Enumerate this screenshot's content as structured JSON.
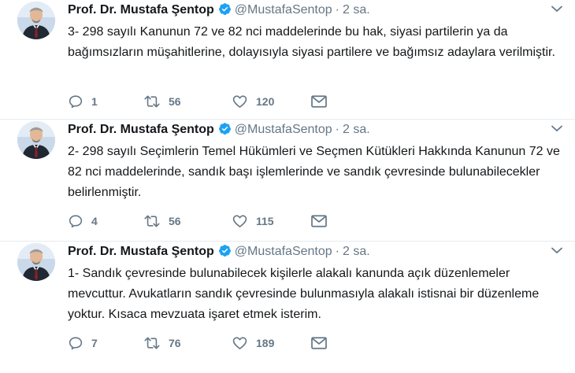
{
  "colors": {
    "verified": "#1da1f2",
    "muted": "#657786",
    "text": "#14171a",
    "divider": "#e6ecf0"
  },
  "icons": {
    "reply": "reply-icon",
    "retweet": "retweet-icon",
    "like": "heart-icon",
    "dm": "envelope-icon",
    "verified": "verified-badge-icon",
    "more": "chevron-down-icon"
  },
  "tweets": [
    {
      "name": "Prof. Dr. Mustafa Şentop",
      "handle": "@MustafaSentop",
      "separator": "·",
      "time": "2 sa.",
      "text": "3- 298 sayılı Kanunun 72 ve 82 nci maddelerinde bu hak, siyasi partilerin ya da bağımsızların müşahitlerine, dolayısıyla siyasi partilere ve bağımsız adaylara verilmiştir.",
      "replies": "1",
      "retweets": "56",
      "likes": "120"
    },
    {
      "name": "Prof. Dr. Mustafa Şentop",
      "handle": "@MustafaSentop",
      "separator": "·",
      "time": "2 sa.",
      "text": "2- 298 sayılı Seçimlerin Temel Hükümleri ve Seçmen Kütükleri Hakkında Kanunun 72 ve 82 nci maddelerinde, sandık başı işlemlerinde ve sandık çevresinde bulunabilecekler belirlenmiştir.",
      "replies": "4",
      "retweets": "56",
      "likes": "115"
    },
    {
      "name": "Prof. Dr. Mustafa Şentop",
      "handle": "@MustafaSentop",
      "separator": "·",
      "time": "2 sa.",
      "text": "1- Sandık çevresinde bulunabilecek kişilerle alakalı kanunda açık düzenlemeler mevcuttur. Avukatların sandık çevresinde bulunmasıyla alakalı istisnai bir düzenleme yoktur. Kısaca mevzuata işaret etmek isterim.",
      "replies": "7",
      "retweets": "76",
      "likes": "189"
    }
  ]
}
